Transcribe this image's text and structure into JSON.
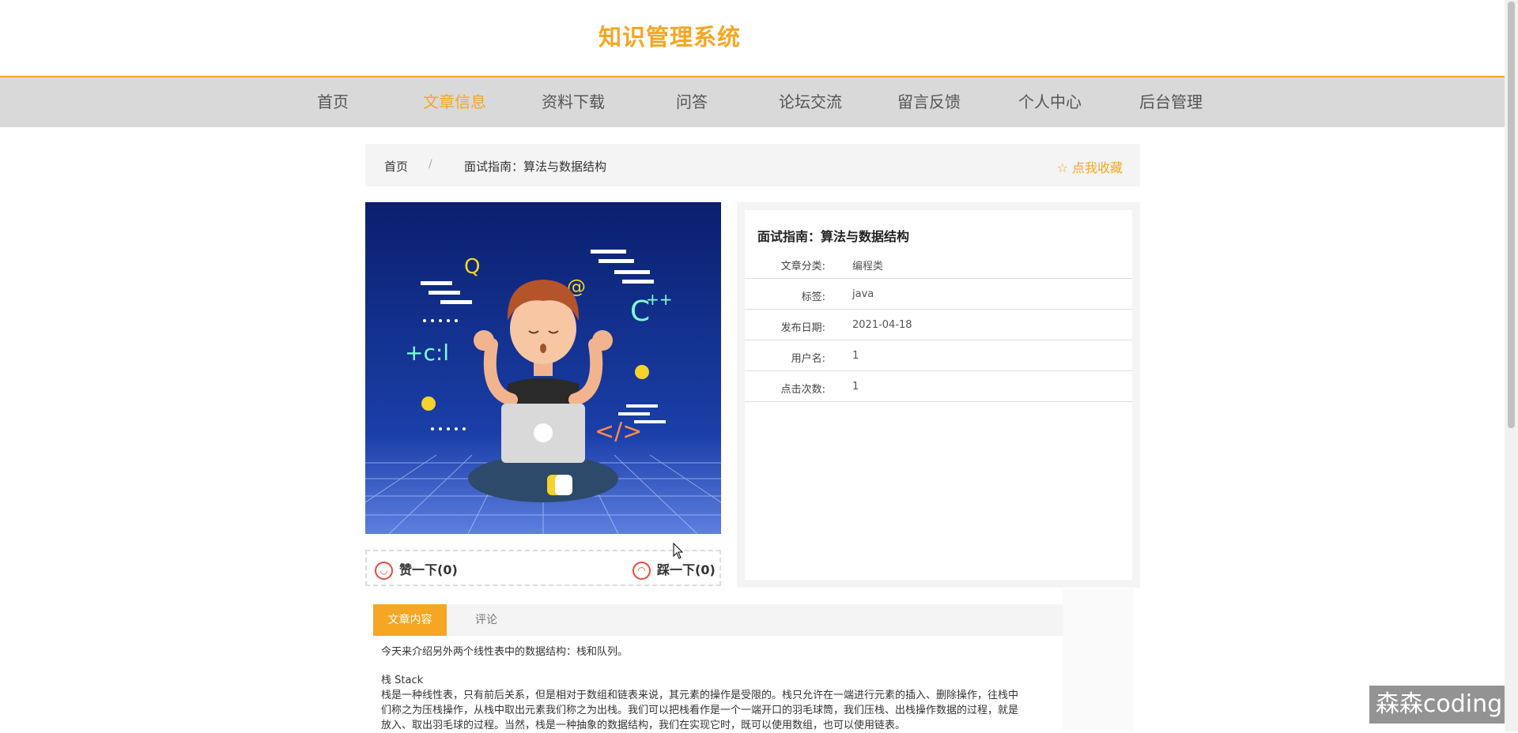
{
  "site": {
    "title": "知识管理系统"
  },
  "nav": {
    "items": [
      {
        "label": "首页"
      },
      {
        "label": "文章信息"
      },
      {
        "label": "资料下载"
      },
      {
        "label": "问答"
      },
      {
        "label": "论坛交流"
      },
      {
        "label": "留言反馈"
      },
      {
        "label": "个人中心"
      },
      {
        "label": "后台管理"
      }
    ],
    "active_index": 1
  },
  "breadcrumb": {
    "home": "首页",
    "separator": "/",
    "current": "面试指南：算法与数据结构",
    "favorite_label": "☆ 点我收藏"
  },
  "votes": {
    "like_label": "赞一下(0)",
    "dislike_label": "踩一下(0)"
  },
  "article_info": {
    "title": "面试指南：算法与数据结构",
    "rows": [
      {
        "label": "文章分类:",
        "value": "编程类"
      },
      {
        "label": "标签:",
        "value": "java"
      },
      {
        "label": "发布日期:",
        "value": "2021-04-18"
      },
      {
        "label": "用户名:",
        "value": "1"
      },
      {
        "label": "点击次数:",
        "value": "1"
      }
    ]
  },
  "tabs": {
    "content_label": "文章内容",
    "comments_label": "评论"
  },
  "content": {
    "intro": "今天来介绍另外两个线性表中的数据结构：栈和队列。",
    "heading": "栈 Stack",
    "line1": "栈是一种线性表，只有前后关系，但是相对于数组和链表来说，其元素的操作是受限的。栈只允许在一端进行元素的插入、删除操作，往栈中",
    "line2": "们称之为压栈操作，从栈中取出元素我们称之为出栈。我们可以把栈看作是一个一端开口的羽毛球筒，我们压栈、出栈操作数据的过程，就是",
    "line3": "放入、取出羽毛球的过程。当然，栈是一种抽象的数据结构，我们在实现它时，既可以使用数组，也可以使用链表。"
  },
  "watermark": "森森coding",
  "colors": {
    "accent": "#f5a623",
    "nav_bg": "#d9d9d9",
    "cover_bg": "#0f2a7a"
  }
}
